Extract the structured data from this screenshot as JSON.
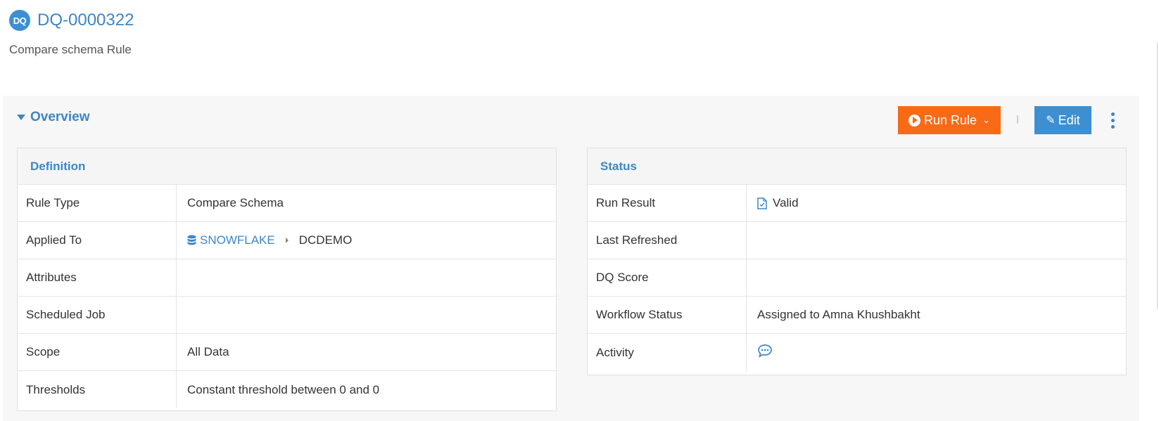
{
  "header": {
    "badge": "DQ",
    "title": "DQ-0000322",
    "subtitle": "Compare schema Rule"
  },
  "overview": {
    "label": "Overview",
    "run_button": "Run Rule",
    "edit_button": "Edit"
  },
  "definition": {
    "title": "Definition",
    "rows": [
      {
        "label": "Rule Type",
        "value": "Compare Schema"
      },
      {
        "label": "Applied To",
        "source": "SNOWFLAKE",
        "target": "DCDEMO"
      },
      {
        "label": "Attributes",
        "value": ""
      },
      {
        "label": "Scheduled Job",
        "value": ""
      },
      {
        "label": "Scope",
        "value": "All Data"
      },
      {
        "label": "Thresholds",
        "value": "Constant threshold between 0 and 0"
      }
    ]
  },
  "status": {
    "title": "Status",
    "rows": [
      {
        "label": "Run Result",
        "value": "Valid"
      },
      {
        "label": "Last Refreshed",
        "value": ""
      },
      {
        "label": "DQ Score",
        "value": ""
      },
      {
        "label": "Workflow Status",
        "value": "Assigned to Amna Khushbakht"
      },
      {
        "label": "Activity",
        "value": ""
      }
    ]
  },
  "colors": {
    "accent": "#3d86c6",
    "run_button": "#f96a16",
    "edit_button": "#3d8fd1"
  }
}
